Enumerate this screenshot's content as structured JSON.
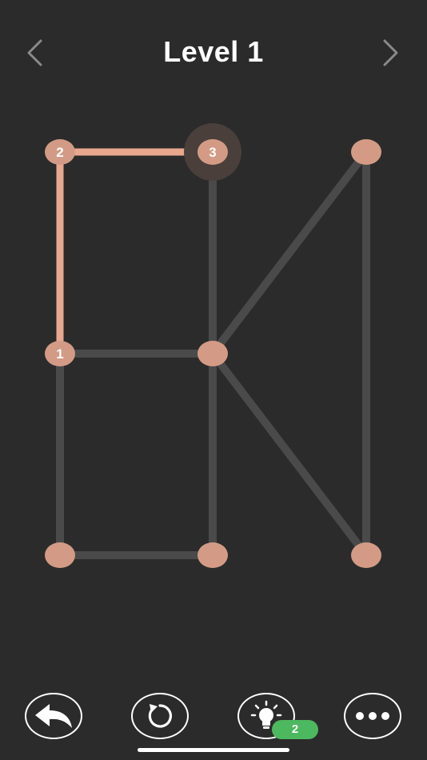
{
  "header": {
    "title": "Level 1",
    "prev_icon": "chevron-left-icon",
    "next_icon": "chevron-right-icon"
  },
  "colors": {
    "background": "#2b2b2b",
    "edge_inactive": "#4a4a4a",
    "edge_active": "#e8a88e",
    "node": "#d39b85",
    "node_highlight": "#4a3f3b",
    "hint_badge": "#4cb85f",
    "icon": "#ffffff"
  },
  "puzzle": {
    "nodes": [
      {
        "id": "A",
        "col": 0,
        "row": 0,
        "label": "2"
      },
      {
        "id": "B",
        "col": 1,
        "row": 0,
        "label": "3",
        "current": true
      },
      {
        "id": "C",
        "col": 2,
        "row": 0,
        "label": ""
      },
      {
        "id": "D",
        "col": 0,
        "row": 1,
        "label": "1"
      },
      {
        "id": "E",
        "col": 1,
        "row": 1,
        "label": ""
      },
      {
        "id": "F",
        "col": 0,
        "row": 2,
        "label": ""
      },
      {
        "id": "G",
        "col": 1,
        "row": 2,
        "label": ""
      },
      {
        "id": "H",
        "col": 2,
        "row": 2,
        "label": ""
      }
    ],
    "edges": [
      {
        "from": "A",
        "to": "B",
        "drawn": true
      },
      {
        "from": "A",
        "to": "D",
        "drawn": true
      },
      {
        "from": "B",
        "to": "E",
        "drawn": false
      },
      {
        "from": "C",
        "to": "E",
        "drawn": false
      },
      {
        "from": "C",
        "to": "H",
        "drawn": false
      },
      {
        "from": "D",
        "to": "E",
        "drawn": false
      },
      {
        "from": "D",
        "to": "F",
        "drawn": false
      },
      {
        "from": "E",
        "to": "G",
        "drawn": false
      },
      {
        "from": "E",
        "to": "H",
        "drawn": false
      },
      {
        "from": "F",
        "to": "G",
        "drawn": false
      }
    ]
  },
  "toolbar": {
    "undo_icon": "undo-arrow-icon",
    "restart_icon": "restart-icon",
    "hint_icon": "lightbulb-icon",
    "hint_count": "2",
    "more_icon": "more-dots-icon"
  }
}
